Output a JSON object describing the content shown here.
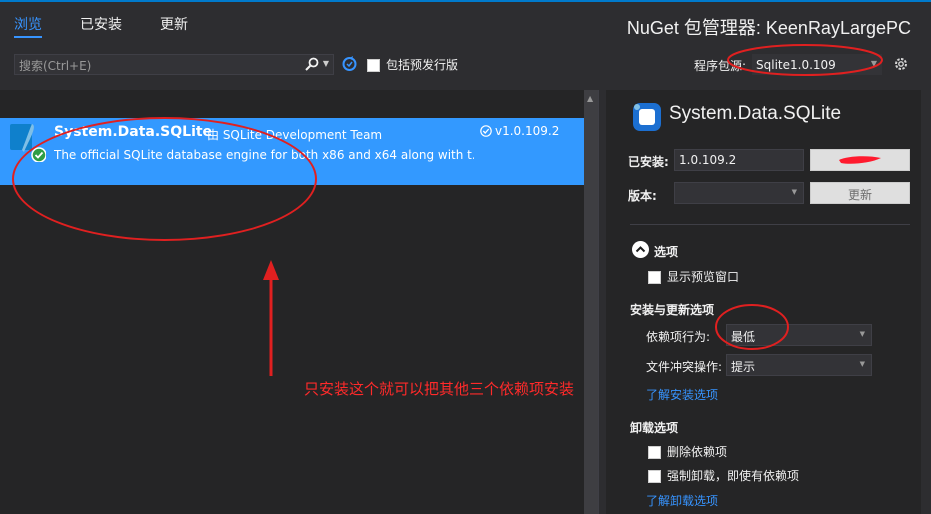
{
  "tabs": [
    {
      "label": "浏览",
      "active": true
    },
    {
      "label": "已安装",
      "active": false
    },
    {
      "label": "更新",
      "active": false
    }
  ],
  "manager_title": "NuGet 包管理器: KeenRayLargePC",
  "search": {
    "placeholder": "搜索(Ctrl+E)"
  },
  "prerelease_label": "包括预发行版",
  "package_source": {
    "label": "程序包源:",
    "value": "Sqlite1.0.109"
  },
  "package_list": [
    {
      "name": "System.Data.SQLite",
      "by": "由 SQLite Development Team",
      "version": "v1.0.109.2",
      "description": "The official SQLite database engine for both x86 and x64 along with t..."
    }
  ],
  "annotation": {
    "text": "只安装这个就可以把其他三个依赖项安装",
    "color": "#ff2a2a"
  },
  "detail": {
    "title": "System.Data.SQLite",
    "installed_label": "已安装:",
    "installed_value": "1.0.109.2",
    "version_label": "版本:",
    "update_button": "更新",
    "options_header": "选项",
    "show_preview": "显示预览窗口",
    "install_update_header": "安装与更新选项",
    "dependency_label": "依赖项行为:",
    "dependency_value": "最低",
    "conflict_label": "文件冲突操作:",
    "conflict_value": "提示",
    "learn_install": "了解安装选项",
    "uninstall_header": "卸载选项",
    "remove_deps": "删除依赖项",
    "force_uninstall": "强制卸载，即使有依赖项",
    "learn_uninstall": "了解卸载选项"
  },
  "colors": {
    "accent": "#3794ff",
    "selection": "#3399ff",
    "annotation": "#e02020"
  }
}
